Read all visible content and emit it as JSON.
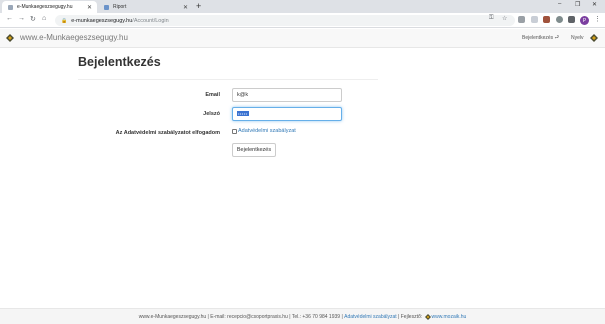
{
  "browser": {
    "tabs": [
      {
        "title": "e-Munkaegeszsegugy.hu"
      },
      {
        "title": "Riport"
      }
    ],
    "new_tab": "+",
    "address": {
      "domain": "e-munkaegeszsegugy.hu",
      "path": "/Account/Login"
    },
    "profile_initial": "P",
    "window_controls": {
      "minimize": "–",
      "restore": "❐",
      "close": "✕"
    }
  },
  "site": {
    "brand": "www.e-Munkaegeszsegugy.hu",
    "nav": {
      "login": "Bejelentkezés",
      "language": "Nyelv"
    },
    "brand_colors": {
      "diamond_dark": "#4b4b2f",
      "diamond_gold": "#d4a017"
    }
  },
  "login_form": {
    "title": "Bejelentkezés",
    "email_label": "Email",
    "email_value": "k@k",
    "password_label": "Jelszó",
    "password_value": "•••••",
    "privacy_label": "Az Adatvédelmi szabályzatot elfogadom",
    "privacy_link": "Adatvédelmi szabályzat",
    "submit": "Bejelentkezés"
  },
  "footer": {
    "text_prefix": "www.e-Munkaegeszsegugy.hu | E-mail: recepcio@csoportpraxis.hu | Tel.: +36 70 984 1939 |",
    "privacy_link": "Adatvédelmi szabályzat",
    "developer_label": "| Fejlesztő:",
    "developer_link": "www.mozaik.hu"
  }
}
